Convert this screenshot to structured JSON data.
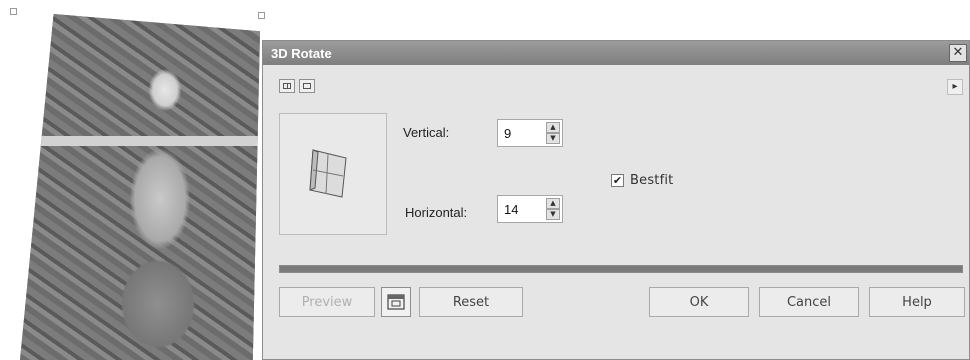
{
  "dialog": {
    "title": "3D Rotate",
    "close_label": "✕",
    "vertical": {
      "label": "Vertical:",
      "value": "9"
    },
    "horizontal": {
      "label": "Horizontal:",
      "value": "14"
    },
    "bestfit": {
      "label": "Bestfit",
      "checked": true,
      "mark": "✔"
    },
    "progress_fraction": 1.0,
    "buttons": {
      "preview": "Preview",
      "reset": "Reset",
      "ok": "OK",
      "cancel": "Cancel",
      "help": "Help"
    }
  },
  "icons": {
    "close": "close-icon",
    "view_split": "split-view-icon",
    "view_single": "single-view-icon",
    "menu": "menu-arrow-icon",
    "preview_toggle": "preview-toggle-icon",
    "rotate_preview": "3d-plane-icon"
  },
  "colors": {
    "titlebar": "#8a8a8a",
    "dialog_bg": "#e5e5e5",
    "progress": "#7a7a7a"
  }
}
